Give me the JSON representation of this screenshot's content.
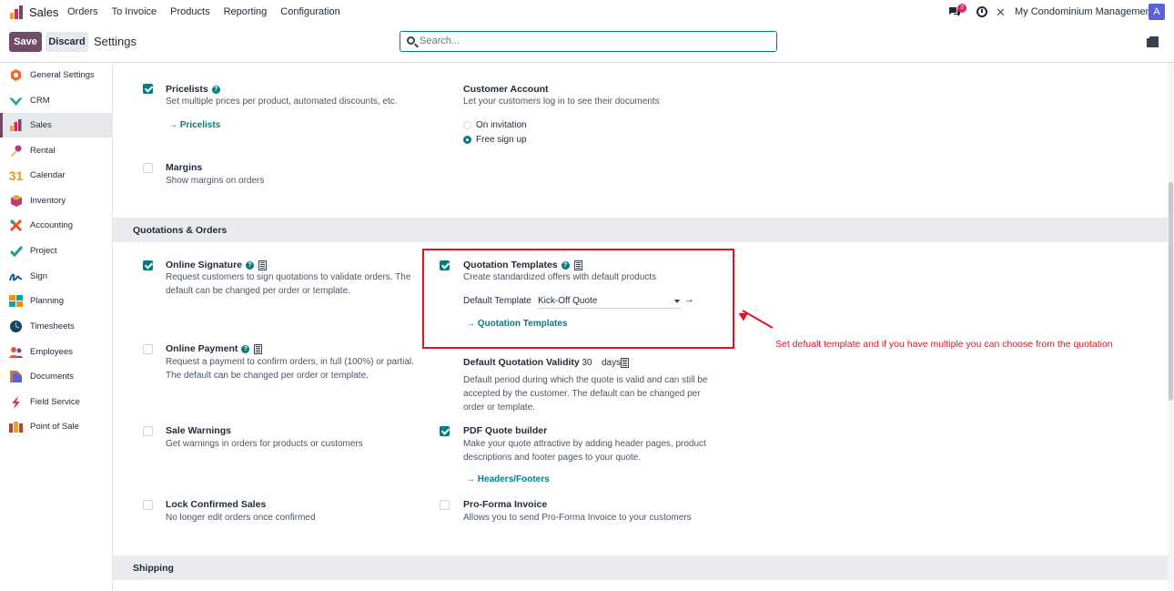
{
  "app": {
    "title": "Sales",
    "menu": [
      "Orders",
      "To Invoice",
      "Products",
      "Reporting",
      "Configuration"
    ],
    "notification_count": "3",
    "company": "My Condominium Management",
    "avatar_letter": "A"
  },
  "control": {
    "save_label": "Save",
    "discard_label": "Discard",
    "page_title": "Settings",
    "search_placeholder": "Search..."
  },
  "sidebar": {
    "items": [
      {
        "label": "General Settings",
        "icon": "general-settings-icon",
        "color": "#f06a2c"
      },
      {
        "label": "CRM",
        "icon": "crm-icon",
        "color": "#1e9d9d"
      },
      {
        "label": "Sales",
        "icon": "sales-icon",
        "color": "#f0a21b",
        "active": true
      },
      {
        "label": "Rental",
        "icon": "rental-icon",
        "color": "#b3348c"
      },
      {
        "label": "Calendar",
        "icon": "calendar-icon",
        "color": "#d9a11a"
      },
      {
        "label": "Inventory",
        "icon": "inventory-icon",
        "color": "#c13979"
      },
      {
        "label": "Accounting",
        "icon": "accounting-icon",
        "color": "#e4572e"
      },
      {
        "label": "Project",
        "icon": "project-icon",
        "color": "#1f9e89"
      },
      {
        "label": "Sign",
        "icon": "sign-icon",
        "color": "#0f5d8a"
      },
      {
        "label": "Planning",
        "icon": "planning-icon",
        "color": "#ef8e23"
      },
      {
        "label": "Timesheets",
        "icon": "timesheets-icon",
        "color": "#17415e"
      },
      {
        "label": "Employees",
        "icon": "employees-icon",
        "color": "#e05a3a"
      },
      {
        "label": "Documents",
        "icon": "documents-icon",
        "color": "#d9771f"
      },
      {
        "label": "Field Service",
        "icon": "field-service-icon",
        "color": "#d13863"
      },
      {
        "label": "Point of Sale",
        "icon": "point-of-sale-icon",
        "color": "#b24a2a"
      }
    ]
  },
  "pricing": {
    "pricelists_title": "Pricelists",
    "pricelists_desc": "Set multiple prices per product, automated discounts, etc.",
    "pricelists_link": "Pricelists",
    "customer_account_title": "Customer Account",
    "customer_account_desc": "Let your customers log in to see their documents",
    "radio_on_invitation": "On invitation",
    "radio_free_signup": "Free sign up",
    "margins_title": "Margins",
    "margins_desc": "Show margins on orders"
  },
  "quotations": {
    "section_title": "Quotations & Orders",
    "online_signature_title": "Online Signature",
    "online_signature_desc": "Request customers to sign quotations to validate orders. The default can be changed per order or template.",
    "quotation_templates_title": "Quotation Templates",
    "quotation_templates_desc": "Create standardized offers with default products",
    "default_template_label": "Default Template",
    "default_template_value": "Kick-Off Quote",
    "quotation_templates_link": "Quotation Templates",
    "online_payment_title": "Online Payment",
    "online_payment_desc": "Request a payment to confirm orders, in full (100%) or partial. The default can be changed per order or template.",
    "validity_title": "Default Quotation Validity",
    "validity_value": "30",
    "validity_unit": "days",
    "validity_desc": "Default period during which the quote is valid and can still be accepted by the customer. The default can be changed per order or template.",
    "sale_warnings_title": "Sale Warnings",
    "sale_warnings_desc": "Get warnings in orders for products or customers",
    "pdf_builder_title": "PDF Quote builder",
    "pdf_builder_desc": "Make your quote attractive by adding header pages, product descriptions and footer pages to your quote.",
    "headers_footers_link": "Headers/Footers",
    "lock_confirmed_title": "Lock Confirmed Sales",
    "lock_confirmed_desc": "No longer edit orders once confirmed",
    "proforma_title": "Pro-Forma Invoice",
    "proforma_desc": "Allows you to send Pro-Forma Invoice to your customers"
  },
  "shipping": {
    "section_title": "Shipping"
  },
  "annotation": {
    "text": "Set defualt template and if you have multiple you can choose from the quotation",
    "color": "#e0141e"
  },
  "colors": {
    "brand": "#714b67",
    "accent": "#017e84"
  }
}
